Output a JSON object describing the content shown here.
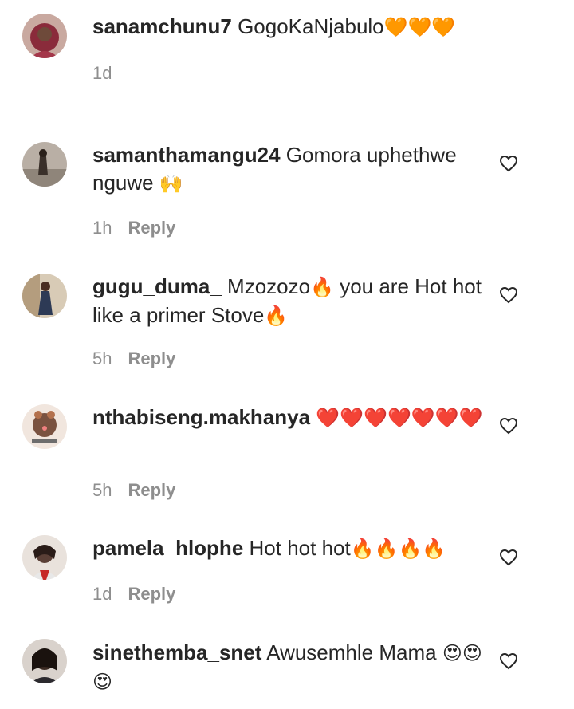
{
  "comments": [
    {
      "username": "sanamchunu7",
      "text": "GogoKaNjabulo",
      "emoji": "🧡🧡🧡",
      "time": "1d",
      "reply_label": "",
      "avatar_color": "#8a2b3b"
    },
    {
      "username": "samanthamangu24",
      "text": "Gomora uphethwe nguwe",
      "emoji": "🙌",
      "time": "1h",
      "reply_label": "Reply",
      "avatar_color": "#9c8f82"
    },
    {
      "username": "gugu_duma_",
      "text": "Mzozozo",
      "emoji": "🔥",
      "text2": "you are Hot hot like a primer Stove",
      "emoji2": "🔥",
      "time": "5h",
      "reply_label": "Reply",
      "avatar_color": "#b8a07a"
    },
    {
      "username": "nthabiseng.makhanya",
      "text": "",
      "emoji": "❤️❤️❤️❤️❤️❤️❤️",
      "time": "5h",
      "reply_label": "Reply",
      "avatar_color": "#6b4a3a"
    },
    {
      "username": "pamela_hlophe",
      "text": "Hot hot hot",
      "emoji": "🔥🔥🔥🔥",
      "time": "1d",
      "reply_label": "Reply",
      "avatar_color": "#5a3f36"
    },
    {
      "username": "sinethemba_snet",
      "text": "Awusemhle Mama",
      "emoji": "😍😍😍",
      "time": "",
      "reply_label": "",
      "avatar_color": "#3b2a22"
    }
  ],
  "icons": {
    "like": "heart-outline-icon"
  }
}
